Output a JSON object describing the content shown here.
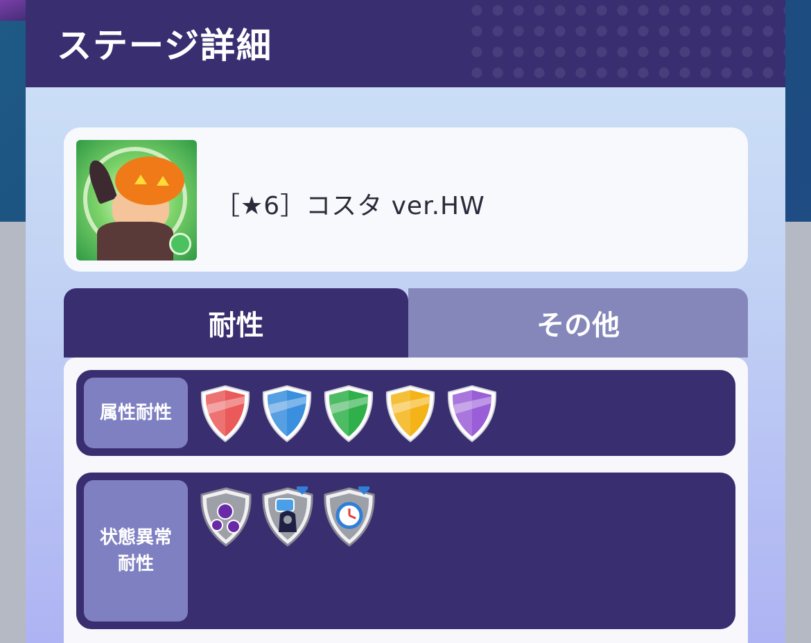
{
  "header": {
    "title": "ステージ詳細"
  },
  "character": {
    "name": "［★6］コスタ ver.HW"
  },
  "tabs": [
    {
      "label": "耐性",
      "active": true
    },
    {
      "label": "その他",
      "active": false
    }
  ],
  "rows": {
    "attribute": {
      "label": "属性耐性",
      "shields": [
        {
          "name": "red-shield",
          "color": "#ea5a5a"
        },
        {
          "name": "blue-shield",
          "color": "#3a8fde"
        },
        {
          "name": "green-shield",
          "color": "#2fb04a"
        },
        {
          "name": "yellow-shield",
          "color": "#f4b418"
        },
        {
          "name": "purple-shield",
          "color": "#9a5ed8"
        }
      ]
    },
    "status": {
      "label_line1": "状態異常",
      "label_line2": "耐性",
      "icons": [
        "poison-shield-icon",
        "bind-shield-icon",
        "time-shield-icon"
      ]
    }
  },
  "colors": {
    "header_bg": "#392e70",
    "row_bg": "#392e70",
    "label_bg": "#7f80c2",
    "tab_inactive": "#8587ba"
  }
}
